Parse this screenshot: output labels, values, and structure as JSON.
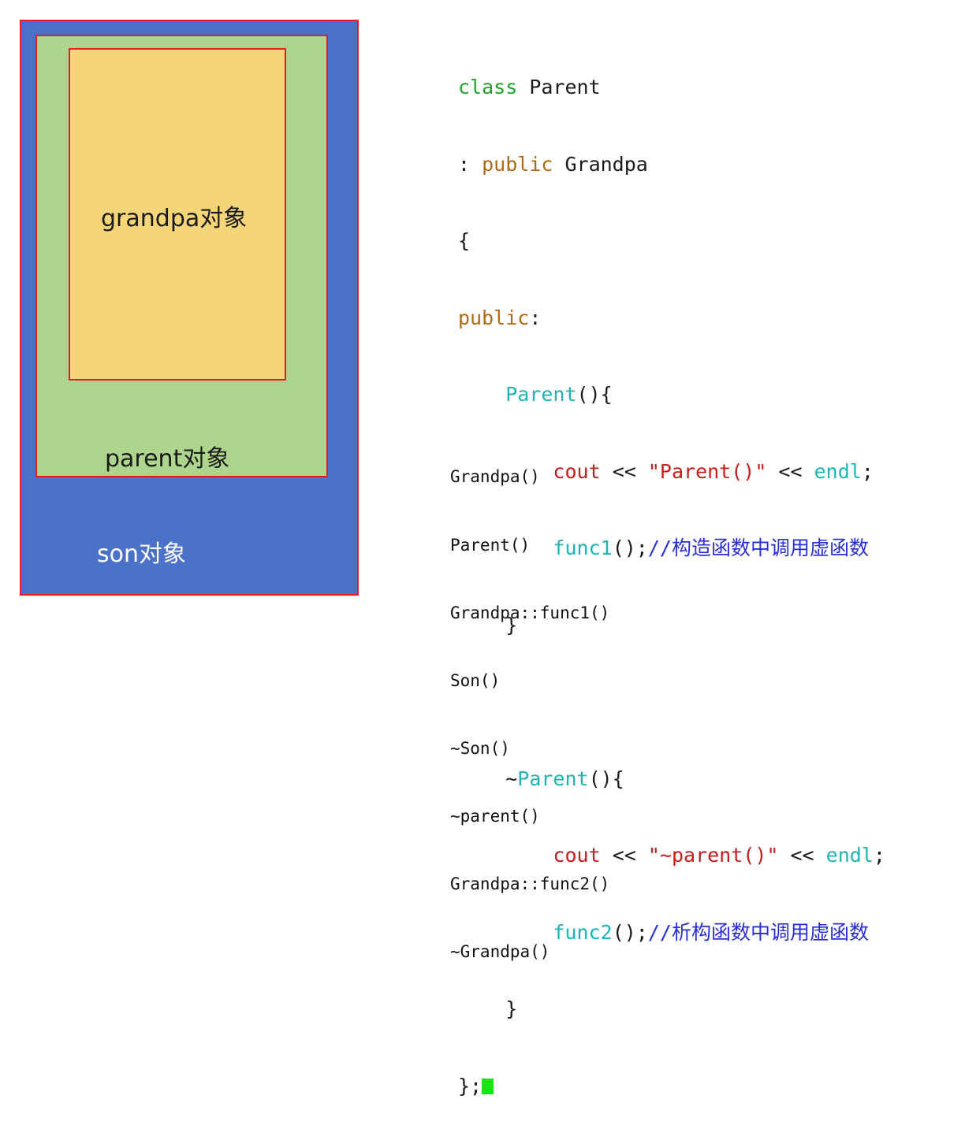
{
  "diagram": {
    "grandpa_label": "grandpa对象",
    "parent_label": "parent对象",
    "son_label": "son对象",
    "colors": {
      "son_fill": "#4a72c9",
      "parent_fill": "#aed58e",
      "grandpa_fill": "#f4d57a",
      "border": "#e21d24"
    }
  },
  "code": {
    "l1_class": "class",
    "l1_name": " Parent",
    "l2_colon": ": ",
    "l2_public": "public",
    "l2_base": " Grandpa",
    "l3_brace": "{",
    "l4_public": "public",
    "l4_colon": ":",
    "l5_indent": "    ",
    "l5_ctor": "Parent",
    "l5_rest": "(){",
    "l6_indent": "        ",
    "l6_cout": "cout",
    "l6_op1": " << ",
    "l6_str": "\"Parent()\"",
    "l6_op2": " << ",
    "l6_endl": "endl",
    "l6_semi": ";",
    "l7_indent": "        ",
    "l7_call": "func1",
    "l7_paren": "();",
    "l7_comment": "//构造函数中调用虚函数",
    "l8_brace": "    }",
    "l10_indent": "    ",
    "l10_tilde": "~",
    "l10_dtor": "Parent",
    "l10_rest": "(){",
    "l11_indent": "        ",
    "l11_cout": "cout",
    "l11_op1": " << ",
    "l11_str": "\"~parent()\"",
    "l11_op2": " << ",
    "l11_endl": "endl",
    "l11_semi": ";",
    "l12_indent": "        ",
    "l12_call": "func2",
    "l12_paren": "();",
    "l12_comment": "//析构函数中调用虚函数",
    "l13_brace": "    }",
    "l14_end": "};",
    "cursor_color": "#14e614"
  },
  "output": {
    "lines": [
      "Grandpa()",
      "Parent()",
      "Grandpa::func1()",
      "Son()",
      "~Son()",
      "~parent()",
      "Grandpa::func2()",
      "~Grandpa()"
    ]
  }
}
